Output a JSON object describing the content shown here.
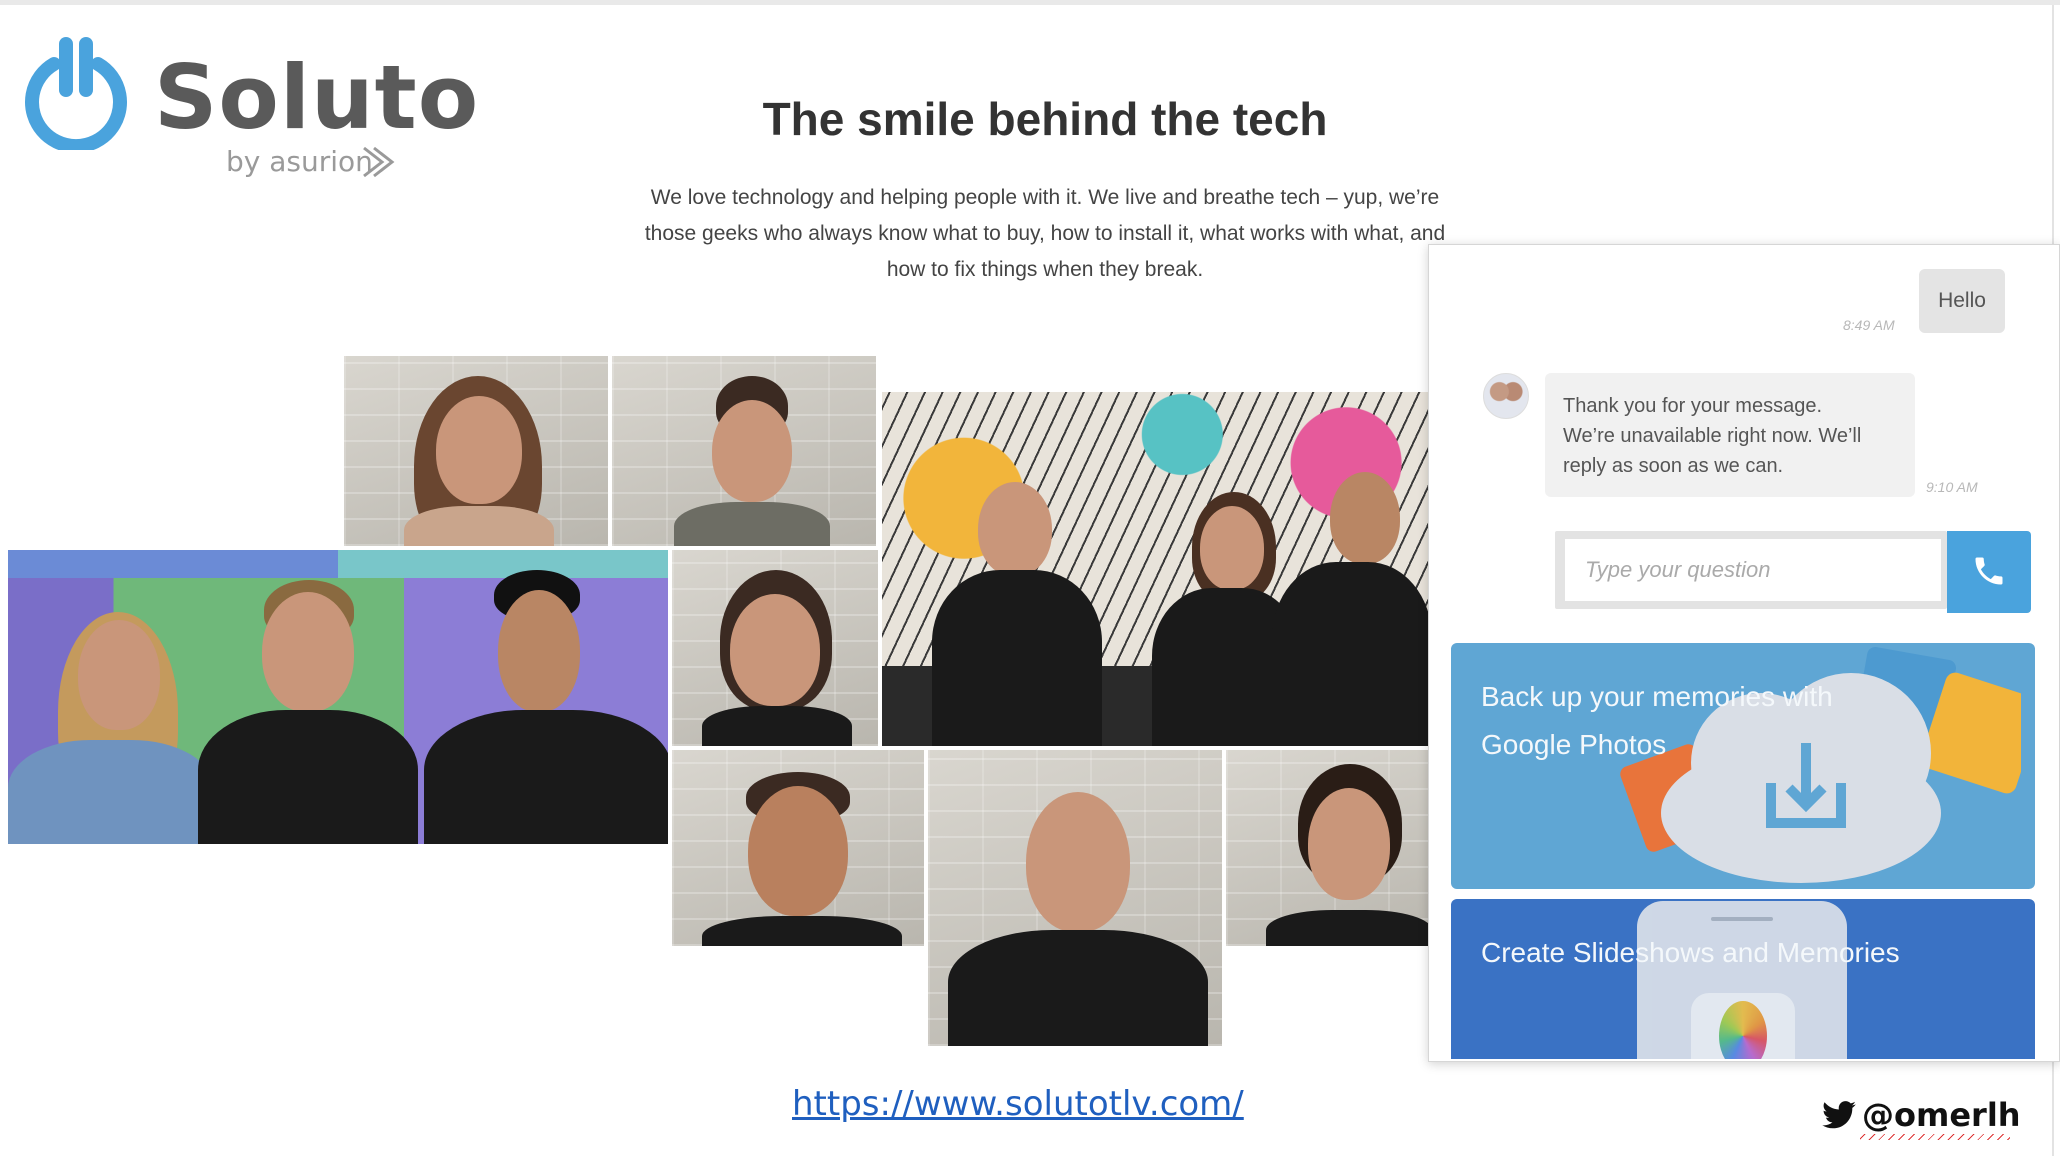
{
  "brand": {
    "name": "Soluto",
    "byline": "by asurion",
    "accent": "#4aa3dd"
  },
  "hero": {
    "title": "The smile behind the tech",
    "intro_lines": [
      "We love technology and helping people with it. We live and breathe tech – yup, we’re",
      "those geeks who always know what to buy, how to install it, what works with what, and",
      "how to fix things when they break."
    ]
  },
  "chat": {
    "messages": [
      {
        "from": "user",
        "text": "Hello",
        "time": "8:49 AM"
      },
      {
        "from": "agent",
        "lines": [
          "Thank you for your message.",
          "We’re unavailable right now. We’ll",
          "reply as soon as we can."
        ],
        "time": "9:10 AM"
      }
    ],
    "input_placeholder": "Type your question",
    "call_icon": "phone-icon",
    "promos": [
      {
        "lines": [
          "Back up your memories with",
          "Google Photos"
        ],
        "color": "#5fa6d4"
      },
      {
        "text": "Create Slideshows and Memories",
        "color": "#3a72c4"
      }
    ]
  },
  "footer": {
    "url": "https://www.solutotlv.com/",
    "handle": "@omerlh",
    "handle_icon": "twitter-icon"
  }
}
